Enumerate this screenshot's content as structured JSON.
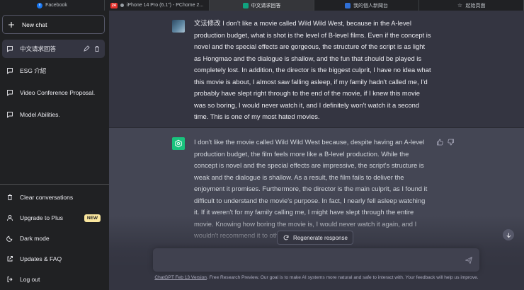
{
  "browser": {
    "tabs": [
      {
        "label": "Facebook",
        "icon": "facebook-icon",
        "active": false
      },
      {
        "label": "iPhone 14 Pro (6.1\") - PChome 2...",
        "icon": "pchome-icon",
        "badge": "24",
        "active": false
      },
      {
        "label": "中文请求回答",
        "icon": "chatgpt-icon",
        "active": true
      },
      {
        "label": "我的個人新聞台",
        "icon": "news-icon",
        "active": false
      },
      {
        "label": "起始頁面",
        "icon": "star-icon",
        "active": false
      }
    ]
  },
  "sidebar": {
    "new_chat": "New chat",
    "conversations": [
      {
        "label": "中文请求回答",
        "active": true
      },
      {
        "label": "ESG 介紹",
        "active": false
      },
      {
        "label": "Video Conference Proposal.",
        "active": false
      },
      {
        "label": "Model Abilities.",
        "active": false
      }
    ],
    "bottom": {
      "clear": "Clear conversations",
      "upgrade": "Upgrade to Plus",
      "new_badge": "NEW",
      "dark_mode": "Dark mode",
      "updates": "Updates & FAQ",
      "logout": "Log out"
    }
  },
  "chat": {
    "user_message": "文法修改 I don't like a movie called Wild Wild West, because in the A-level production budget, what is shot is the level of B-level films. Even if the concept is novel and the special effects are gorgeous, the structure of the script is as light as Hongmao and the dialogue is shallow, and the fun that should be played is completely lost. In addition, the director is the biggest culprit, I have no idea what this movie is about, I almost saw falling asleep, if my family hadn't called me, I'd probably have slept right through to the end of the movie, if I knew this movie was so boring, I would never watch it, and I definitely won't watch it a second time. This is one of my most hated movies.",
    "assistant_message": "I don't like the movie called Wild Wild West because, despite having an A-level production budget, the film feels more like a B-level production. While the concept is novel and the special effects are impressive, the script's structure is weak and the dialogue is shallow. As a result, the film fails to deliver the enjoyment it promises. Furthermore, the director is the main culprit, as I found it difficult to understand the movie's purpose. In fact, I nearly fell asleep watching it. If it weren't for my family calling me, I might have slept through the entire movie. Knowing how boring the movie is, I would never watch it again, and I wouldn't recommend it to others. This is",
    "regenerate_label": "Regenerate response",
    "input_placeholder": "",
    "footer_link": "ChatGPT Feb 13 Version",
    "footer_text": ". Free Research Preview. Our goal is to make AI systems more natural and safe to interact with. Your feedback will help us improve."
  },
  "colors": {
    "sidebar_bg": "#202123",
    "main_bg": "#343541",
    "assistant_bg": "#444654",
    "accent": "#19c37d",
    "new_badge": "#fae69e"
  }
}
